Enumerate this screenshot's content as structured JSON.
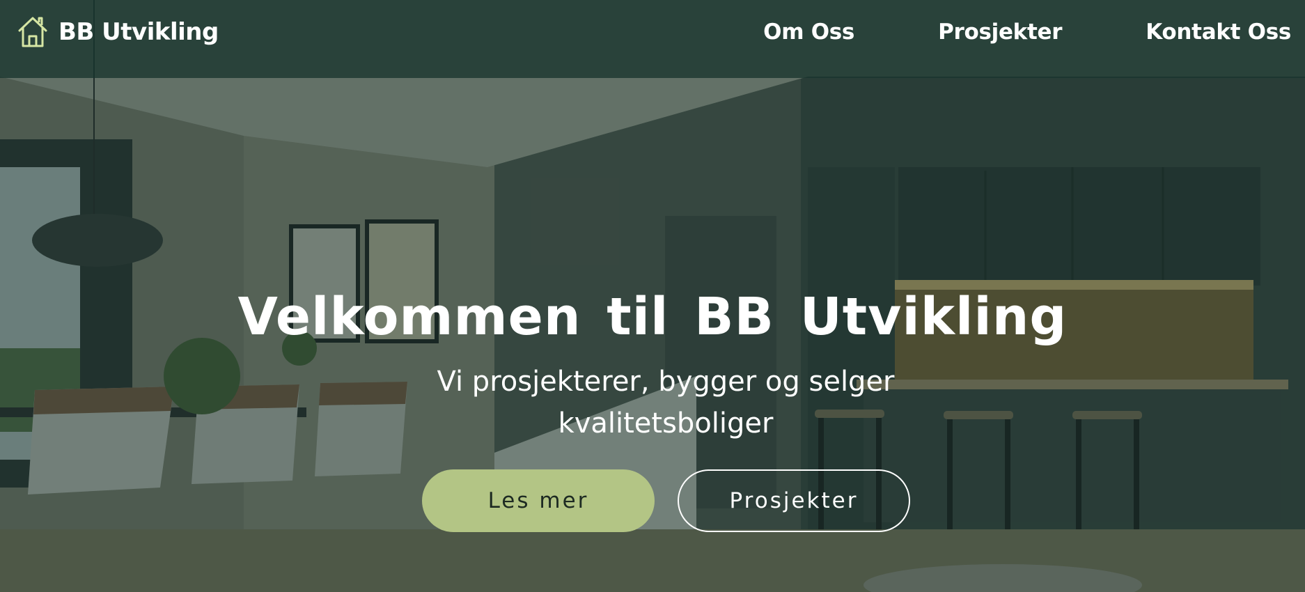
{
  "header": {
    "brand": {
      "name": "BB Utvikling",
      "icon": "home-icon",
      "icon_color": "#d6e6a4"
    },
    "nav": [
      {
        "label": "Om Oss"
      },
      {
        "label": "Prosjekter"
      },
      {
        "label": "Kontakt Oss"
      }
    ]
  },
  "hero": {
    "title": "Velkommen til BB Utvikling",
    "subtitle": "Vi prosjekterer, bygger og selger kvalitetsboliger",
    "buttons": {
      "primary_label": "Les mer",
      "secondary_label": "Prosjekter"
    }
  },
  "colors": {
    "accent": "#b3c585",
    "overlay": "#16302a",
    "text": "#ffffff"
  }
}
